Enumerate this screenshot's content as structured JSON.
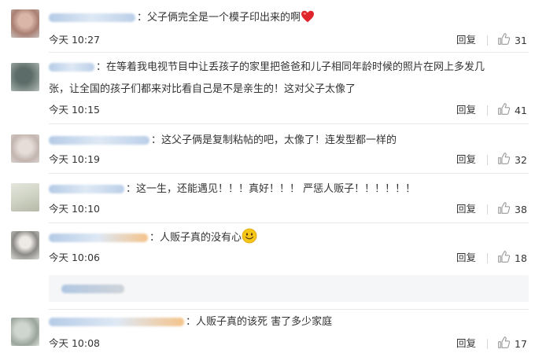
{
  "comments": [
    {
      "text": "：父子俩完全是一个模子印出来的啊",
      "emoji": "heart-icon",
      "time": "今天 10:27",
      "reply_label": "回复",
      "likes": "31"
    },
    {
      "text": "：在等着我电视节目中让丢孩子的家里把爸爸和儿子相同年龄时候的照片在网上多发几",
      "text_line2": "张，让全国的孩子们都来对比看自己是不是亲生的！这对父子太像了",
      "time": "今天 10:15",
      "reply_label": "回复",
      "likes": "41"
    },
    {
      "text": "：这父子俩是复制粘帖的吧，太像了！连发型都一样的",
      "time": "今天 10:19",
      "reply_label": "回复",
      "likes": "32"
    },
    {
      "text": "：这一生，还能遇见！！！真好！！！ 严惩人贩子！！！！！！",
      "time": "今天 10:10",
      "reply_label": "回复",
      "likes": "38"
    },
    {
      "text": "：人贩子真的没有心",
      "emoji": "smile-icon",
      "time": "今天 10:06",
      "reply_label": "回复",
      "likes": "18"
    },
    {
      "text": "：人贩子真的该死  害了多少家庭",
      "time": "今天 10:08",
      "reply_label": "回复",
      "likes": "17"
    }
  ],
  "colors": {
    "text": "#333333",
    "divider": "#e8e8e8",
    "heart": "#e0242b",
    "smile": "#f5c518",
    "like_icon": "#9a9a9a",
    "subreply_bg": "#f5f6f7"
  }
}
